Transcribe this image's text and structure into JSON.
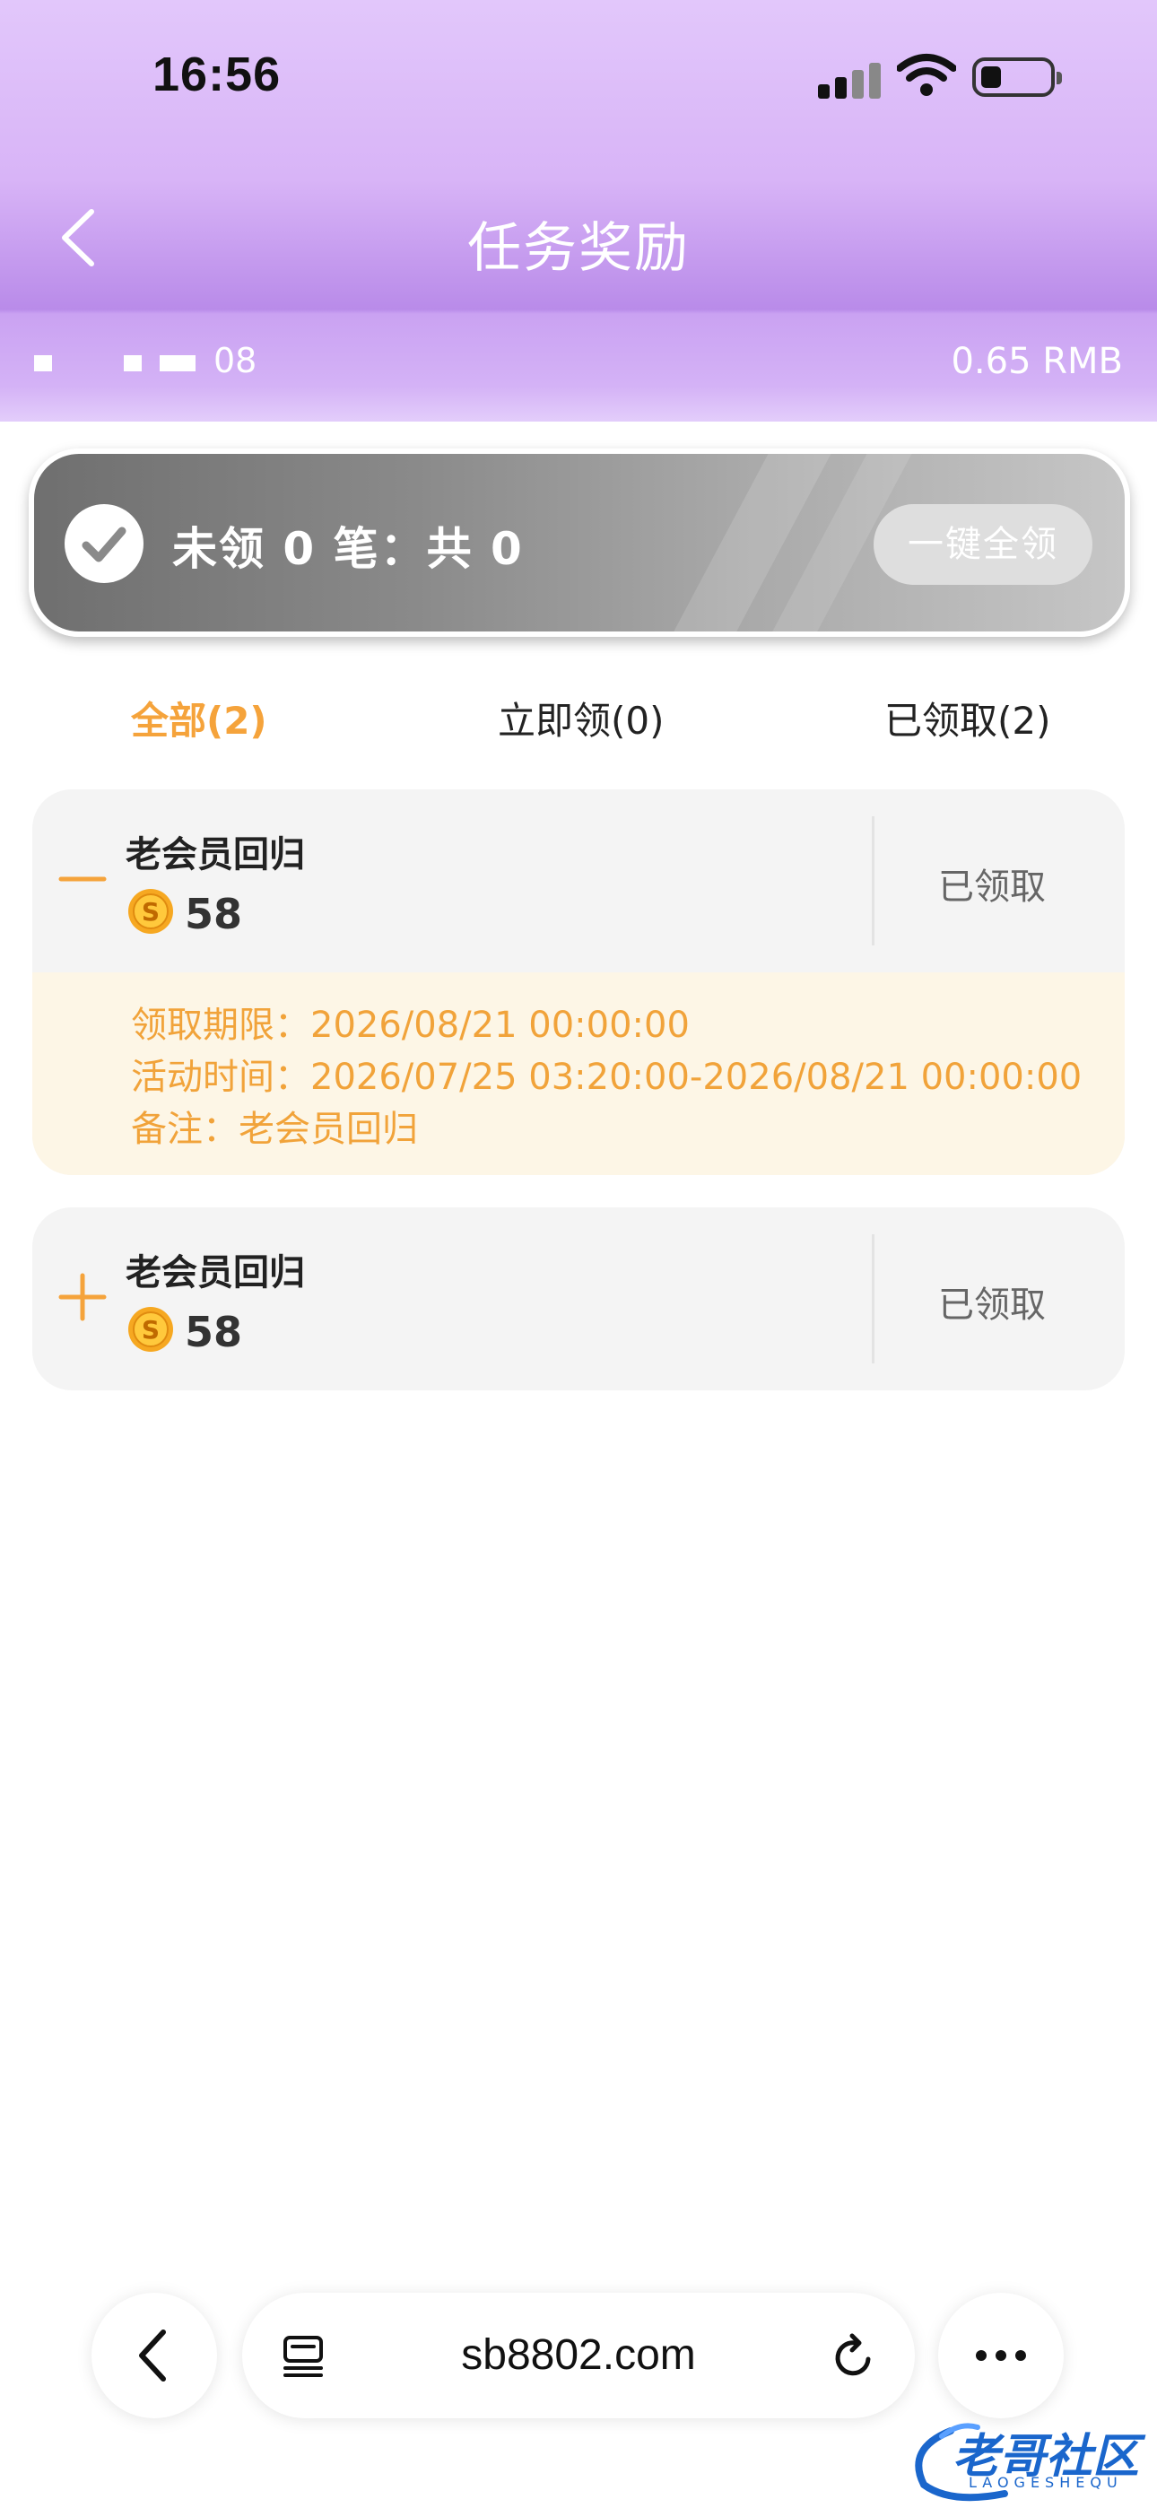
{
  "status_bar": {
    "time": "16:56"
  },
  "nav": {
    "title": "任务奖励"
  },
  "account": {
    "id_suffix": "08",
    "balance": "0.65 RMB"
  },
  "summary": {
    "text": "未领 0 笔：共 0",
    "claim_all_label": "一键全领"
  },
  "tabs": [
    {
      "label": "全部(2)",
      "active": true
    },
    {
      "label": "立即领(0)",
      "active": false
    },
    {
      "label": "已领取(2)",
      "active": false
    }
  ],
  "rewards": [
    {
      "title": "老会员回归",
      "amount": "58",
      "status": "已领取",
      "expanded": true,
      "details": [
        "领取期限：2026/08/21 00:00:00",
        "活动时间：2026/07/25 03:20:00-2026/08/21 00:00:00",
        "备注：老会员回归"
      ]
    },
    {
      "title": "老会员回归",
      "amount": "58",
      "status": "已领取",
      "expanded": false
    }
  ],
  "browser": {
    "url": "sb8802.com"
  },
  "watermark": {
    "text": "老哥社区",
    "sub": "LAOGESHEQU"
  },
  "colors": {
    "accent": "#f5a33b",
    "header_purple": "#d8b4f7",
    "detail_bg": "#fdf6e6"
  }
}
